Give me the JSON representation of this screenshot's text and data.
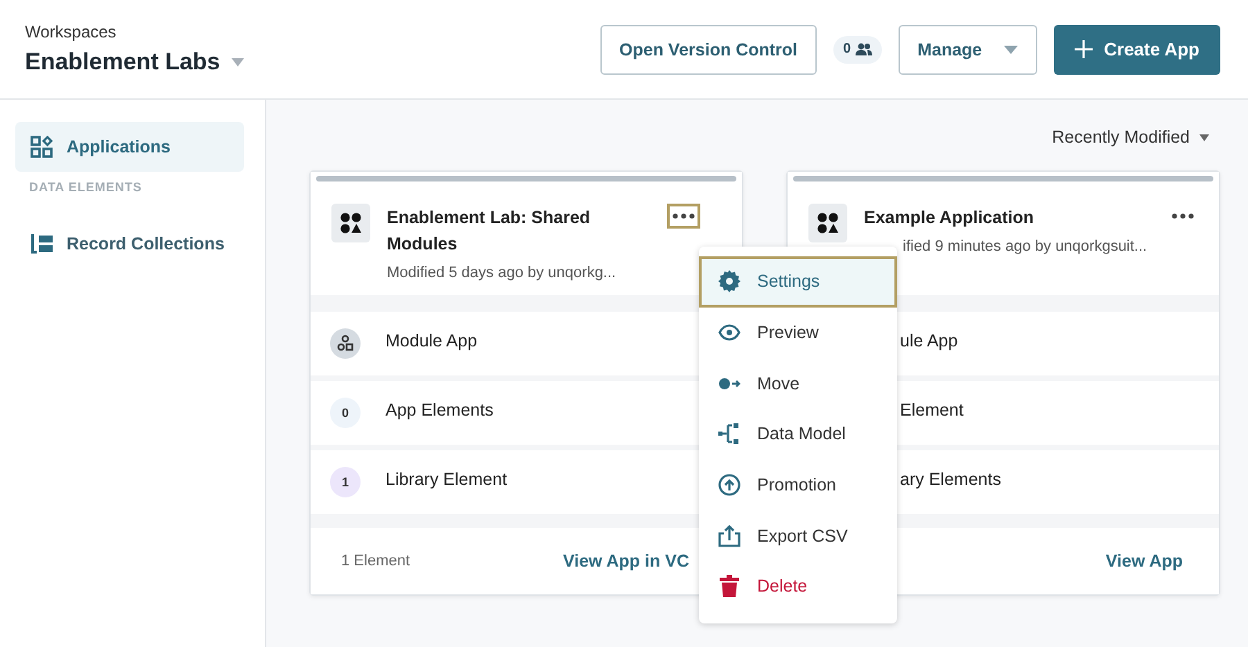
{
  "header": {
    "breadcrumb": "Workspaces",
    "workspace": "Enablement Labs",
    "version_control": "Open Version Control",
    "collaborators": "0",
    "manage": "Manage",
    "create": "Create App"
  },
  "sidebar": {
    "items": [
      {
        "label": "Applications",
        "kind": "apps",
        "selected": true
      },
      {
        "label": "DATA ELEMENTS",
        "kind": "section"
      },
      {
        "label": "Record Collections",
        "kind": "records",
        "selected": false
      }
    ]
  },
  "sort": "Recently Modified",
  "cards": [
    {
      "title": "Enablement Lab: Shared Modules",
      "subtitle": "Modified 5 days ago by unqorkg...",
      "menu_focused": true,
      "partial": false,
      "rows": [
        {
          "kind": "module",
          "label": "Module App"
        },
        {
          "kind": "count",
          "badge": "0",
          "color": "#eef4fa",
          "label": "App Elements"
        },
        {
          "kind": "count",
          "badge": "1",
          "color": "#ece6fb",
          "label": "Library Element"
        }
      ],
      "footer_count": "1 Element",
      "link": "View App in VC"
    },
    {
      "title": "Example Application",
      "subtitle": "ified 9 minutes ago by unqorkgsuit...",
      "menu_focused": false,
      "partial": true,
      "rows": [
        {
          "kind": "plain",
          "label": "ule App"
        },
        {
          "kind": "plain",
          "label": "Element"
        },
        {
          "kind": "plain",
          "label": "ary Elements"
        }
      ],
      "link": "View App"
    }
  ],
  "menu": {
    "items": [
      {
        "label": "Settings",
        "kind": "settings",
        "selected": true
      },
      {
        "label": "Preview",
        "kind": "preview",
        "selected": false
      },
      {
        "label": "Move",
        "kind": "move",
        "selected": false
      },
      {
        "label": "Data Model",
        "kind": "data-model",
        "selected": false
      },
      {
        "label": "Promotion",
        "kind": "promotion",
        "selected": false
      },
      {
        "label": "Export CSV",
        "kind": "export",
        "selected": false
      },
      {
        "label": "Delete",
        "kind": "delete",
        "selected": false
      }
    ]
  }
}
